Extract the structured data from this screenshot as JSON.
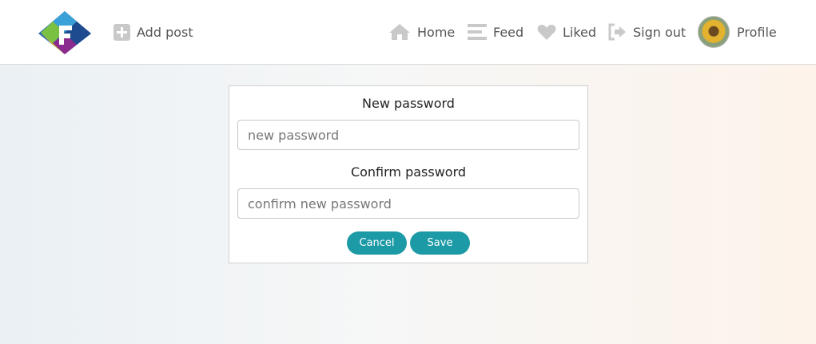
{
  "nav": {
    "add_post": "Add post",
    "home": "Home",
    "feed": "Feed",
    "liked": "Liked",
    "sign_out": "Sign out",
    "profile": "Profile"
  },
  "form": {
    "new_password_label": "New password",
    "new_password_placeholder": "new password",
    "confirm_password_label": "Confirm password",
    "confirm_password_placeholder": "confirm new password",
    "cancel_label": "Cancel",
    "save_label": "Save"
  },
  "colors": {
    "accent": "#1c9aa6",
    "icon": "#c9c9c9"
  },
  "icons": [
    "logo-icon",
    "plus-square-icon",
    "home-icon",
    "feed-icon",
    "heart-icon",
    "sign-out-icon",
    "avatar"
  ]
}
